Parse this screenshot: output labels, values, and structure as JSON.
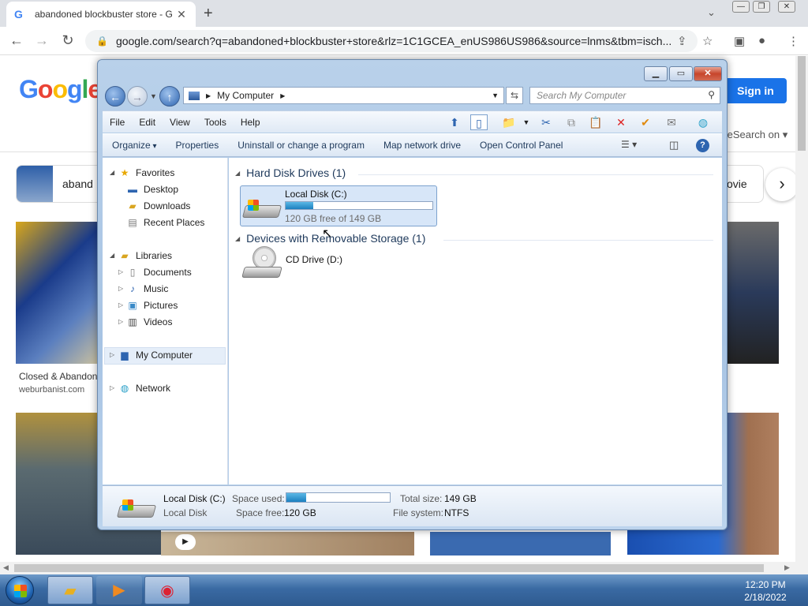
{
  "browser": {
    "tab_title": "abandoned blockbuster store - G",
    "tab_close": "✕",
    "new_tab": "+",
    "url": "google.com/search?q=abandoned+blockbuster+store&rlz=1C1GCEA_enUS986US986&source=lnms&tbm=isch..."
  },
  "google": {
    "logo_letters": [
      "G",
      "o",
      "o",
      "g",
      "l",
      "e"
    ],
    "logo_colors": [
      "#4285f4",
      "#ea4335",
      "#fbbc05",
      "#4285f4",
      "#34a853",
      "#ea4335"
    ],
    "sign_in": "Sign in",
    "safesearch": "feSearch on ▾",
    "chip_left": "aband",
    "chip_right": "ovie",
    "caption": "Closed & Abandon",
    "caption_source": "weburbanist.com"
  },
  "explorer": {
    "address": "My Computer",
    "search_placeholder": "Search My Computer",
    "menu": [
      "File",
      "Edit",
      "View",
      "Tools",
      "Help"
    ],
    "commands": {
      "organize": "Organize",
      "properties": "Properties",
      "uninstall": "Uninstall or change a program",
      "map_drive": "Map network drive",
      "control_panel": "Open Control Panel"
    },
    "nav": {
      "favorites": "Favorites",
      "desktop": "Desktop",
      "downloads": "Downloads",
      "recent": "Recent Places",
      "libraries": "Libraries",
      "documents": "Documents",
      "music": "Music",
      "pictures": "Pictures",
      "videos": "Videos",
      "my_computer": "My Computer",
      "network": "Network"
    },
    "groups": {
      "hdd": "Hard Disk Drives (1)",
      "removable": "Devices with Removable Storage (1)"
    },
    "local_disk": {
      "name": "Local Disk (C:)",
      "free_text": "120 GB free of 149 GB",
      "used_fraction": 0.19
    },
    "cd_drive": "CD Drive (D:)",
    "details": {
      "name": "Local Disk (C:)",
      "type": "Local Disk",
      "space_used_label": "Space used:",
      "space_free_label": "Space free:",
      "space_free": "120 GB",
      "total_size_label": "Total size:",
      "total_size": "149 GB",
      "filesystem_label": "File system:",
      "filesystem": "NTFS"
    }
  },
  "taskbar": {
    "time": "12:20 PM",
    "date": "2/18/2022"
  }
}
